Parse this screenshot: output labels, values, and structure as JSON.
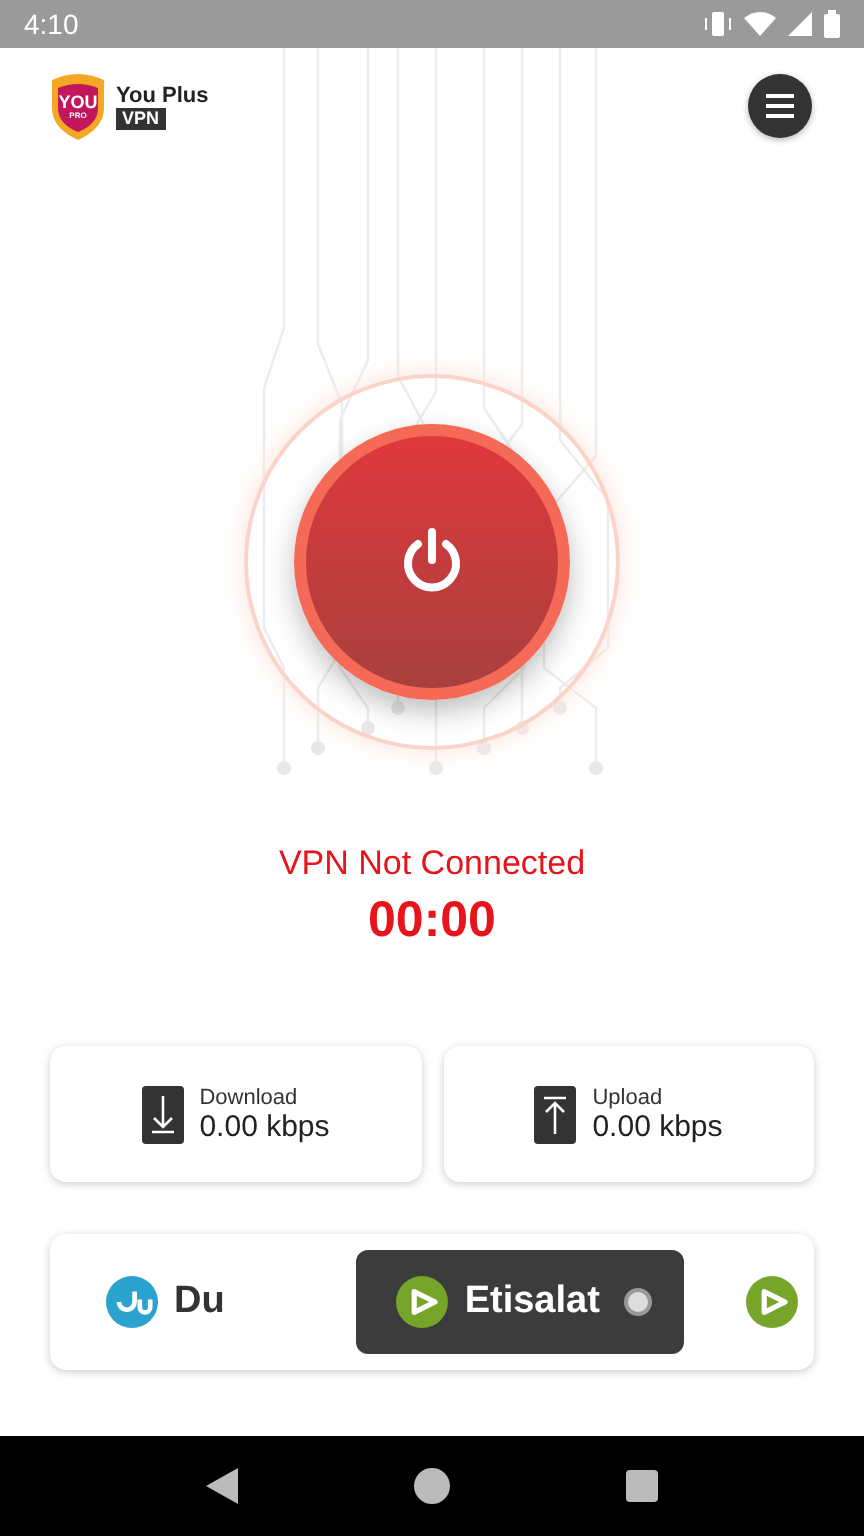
{
  "status_bar": {
    "time": "4:10"
  },
  "header": {
    "badge_top": "YOU",
    "badge_bottom": "PRO",
    "brand": "You Plus",
    "brand_tag": "VPN"
  },
  "connection": {
    "connected": false,
    "status": "VPN Not Connected",
    "timer": "00:00"
  },
  "stats": [
    {
      "kind": "download",
      "label": "Download",
      "value": "0.00 kbps"
    },
    {
      "kind": "upload",
      "label": "Upload",
      "value": "0.00 kbps"
    }
  ],
  "carriers": [
    {
      "kind": "du",
      "name": "Du",
      "selected": false,
      "color": "#2aa3cf"
    },
    {
      "kind": "etisalat",
      "name": "Etisalat",
      "selected": true,
      "color": "#76a52a"
    },
    {
      "kind": "etisalat",
      "selected": false,
      "color": "#76a52a"
    }
  ]
}
